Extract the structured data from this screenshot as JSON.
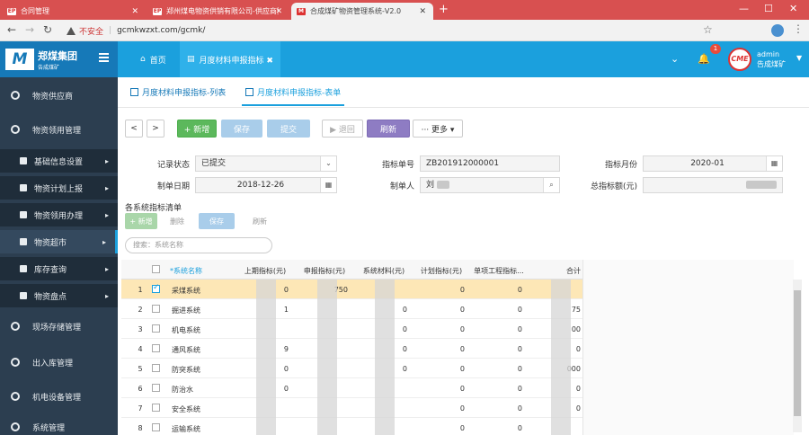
{
  "browser": {
    "tabs": [
      {
        "label": "合同管理",
        "active": false
      },
      {
        "label": "郑州煤电物资供销有限公司-供应商登录",
        "active": false
      },
      {
        "label": "合成煤矿物资管理系统-V2.0",
        "active": true
      }
    ],
    "url": "gcmkwzxt.com/gcmk/",
    "insecure_label": "不安全"
  },
  "header": {
    "company_mark": "M",
    "company_name": "郑煤集团",
    "company_sub": "告成煤矿",
    "tabs": [
      {
        "label": "首页"
      },
      {
        "label": "月度材料申报指标 ✖"
      }
    ],
    "notification_count": "1",
    "avatar_text": "CME",
    "user_name": "admin",
    "user_unit": "告成煤矿"
  },
  "sidebar": {
    "items": [
      {
        "label": "物资供应商",
        "level": 1
      },
      {
        "label": "物资领用管理",
        "level": 1
      },
      {
        "label": "基础信息设置",
        "level": 2
      },
      {
        "label": "物资计划上报",
        "level": 2
      },
      {
        "label": "物资领用办理",
        "level": 2
      },
      {
        "label": "物资超市",
        "level": 2,
        "active": true
      },
      {
        "label": "库存查询",
        "level": 2
      },
      {
        "label": "物资盘点",
        "level": 2
      },
      {
        "label": "现场存储管理",
        "level": 1
      },
      {
        "label": "出入库管理",
        "level": 1
      },
      {
        "label": "机电设备管理",
        "level": 1
      },
      {
        "label": "系统管理",
        "level": 1
      }
    ]
  },
  "subtabs": [
    {
      "label": "月度材料申报指标-列表"
    },
    {
      "label": "月度材料申报指标-表单"
    }
  ],
  "toolbar": {
    "prev": "<",
    "next": ">",
    "add": "+ 新增",
    "save": "保存",
    "submit": "提交",
    "back": "▶ 退回",
    "refresh": "刷新",
    "more": "··· 更多 ▾"
  },
  "form": {
    "status_label": "记录状态",
    "status_value": "已提交",
    "billno_label": "指标单号",
    "billno_value": "ZB201912000001",
    "month_label": "指标月份",
    "month_value": "2020-01",
    "date_label": "制单日期",
    "date_value": "2018-12-26",
    "maker_label": "制单人",
    "maker_value": "刘",
    "amount_label": "总指标额(元)"
  },
  "grid": {
    "title": "各系统指标清单",
    "tools": {
      "add": "+ 新增",
      "delete": "删除",
      "save": "保存",
      "refresh": "刷新"
    },
    "search_placeholder": "搜索：系统名称",
    "headers": [
      "*系统名称",
      "上期指标(元)",
      "申报指标(元)",
      "系统材料(元)",
      "计划指标(元)",
      "单项工程指标...",
      "合计"
    ],
    "rows": [
      {
        "no": "1",
        "name": "采煤系统",
        "c1": "0",
        "c2": "750",
        "c3": "",
        "c4": "0",
        "c5": "0",
        "selected": true
      },
      {
        "no": "2",
        "name": "掘进系统",
        "c1": "1",
        "c2": "",
        "c3": "0",
        "c4": "0",
        "c5": "0",
        "total": "75"
      },
      {
        "no": "3",
        "name": "机电系统",
        "c1": "",
        "c2": "",
        "c3": "0",
        "c4": "0",
        "c5": "0",
        "total": "00"
      },
      {
        "no": "4",
        "name": "通风系统",
        "c1": "9",
        "c2": "",
        "c3": "0",
        "c4": "0",
        "c5": "0",
        "total": "0"
      },
      {
        "no": "5",
        "name": "防突系统",
        "c1": "0",
        "c2": "",
        "c3": "0",
        "c4": "0",
        "c5": "0",
        "total": "000"
      },
      {
        "no": "6",
        "name": "防治水",
        "c1": "0",
        "c2": "",
        "c3": "",
        "c4": "0",
        "c5": "0",
        "total": "0"
      },
      {
        "no": "7",
        "name": "安全系统",
        "c1": "",
        "c2": "",
        "c3": "",
        "c4": "0",
        "c5": "0",
        "total": "0"
      },
      {
        "no": "8",
        "name": "运输系统",
        "c1": "",
        "c2": "",
        "c3": "",
        "c4": "0",
        "c5": "0",
        "total": ""
      }
    ]
  }
}
